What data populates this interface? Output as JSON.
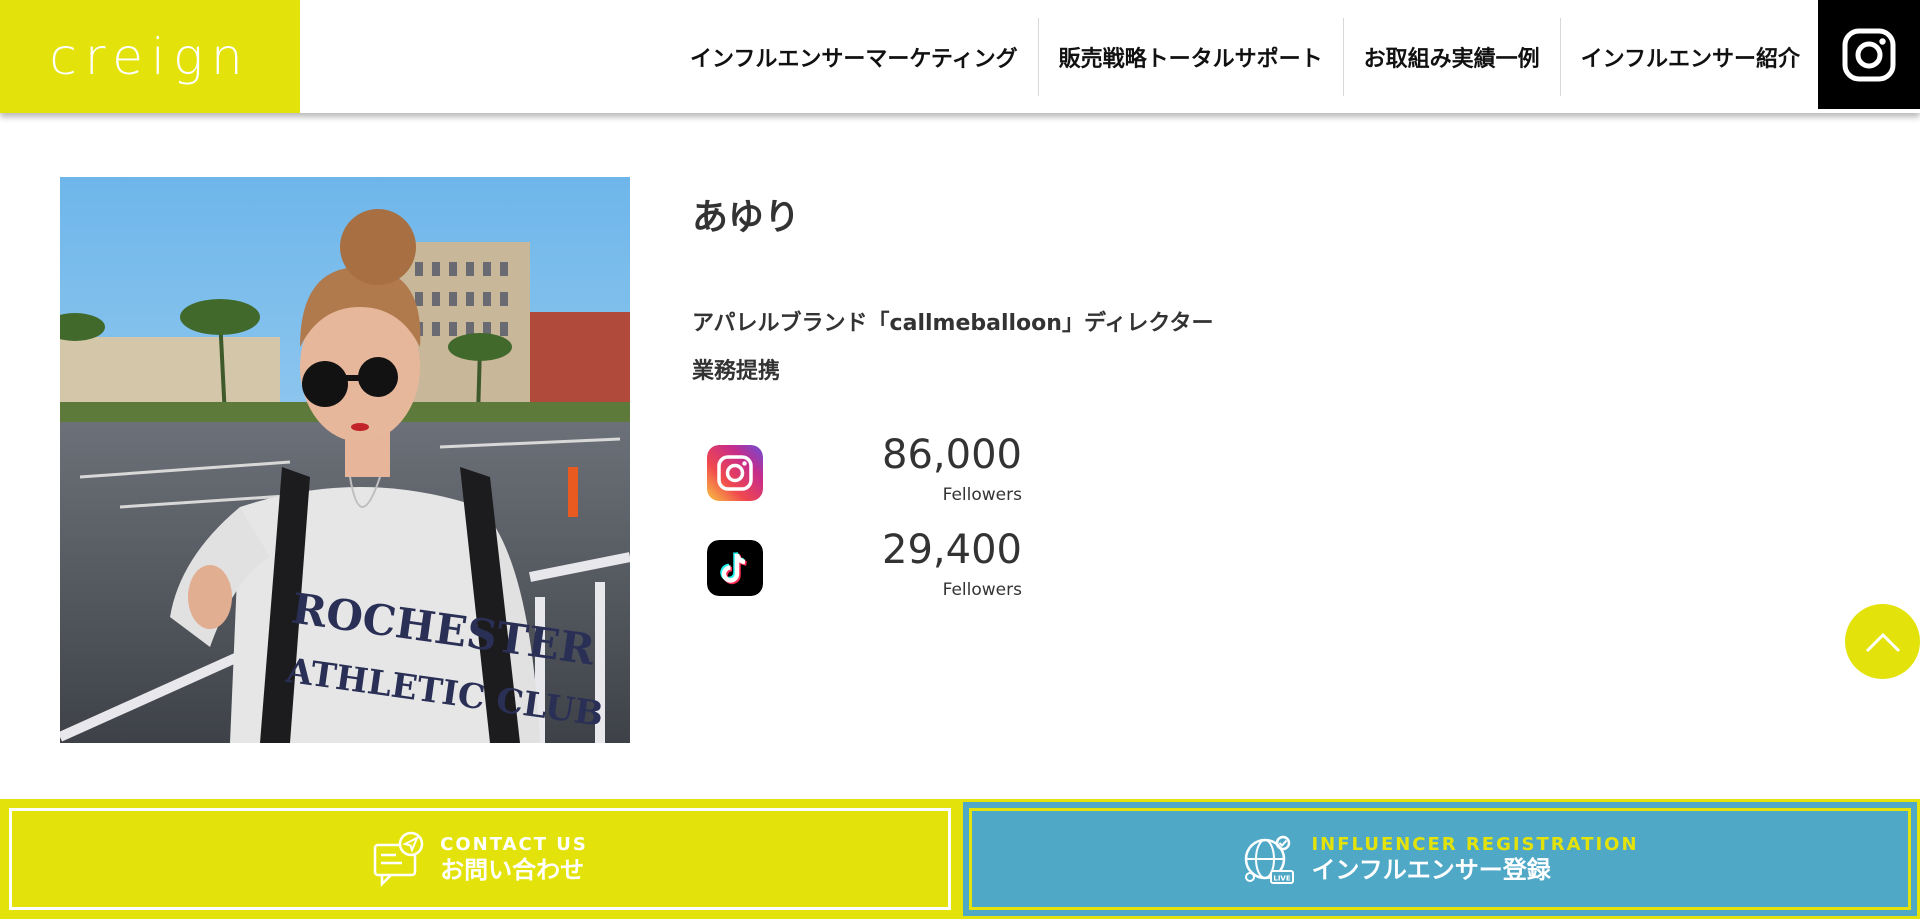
{
  "header": {
    "logo": "creign",
    "nav": [
      {
        "label": "インフルエンサーマーケティング"
      },
      {
        "label": "販売戦略トータルサポート"
      },
      {
        "label": "お取組み実績一例"
      },
      {
        "label": "インフルエンサー紹介"
      }
    ],
    "instagram_icon": "instagram-icon"
  },
  "profile": {
    "name": "あゆり",
    "description_lines": [
      "アパレルブランド「callmeballoon」ディレクター",
      "業務提携"
    ],
    "photo_text": [
      "ROCHESTER",
      "ATHLETIC CLUB"
    ],
    "stats": [
      {
        "platform_icon": "instagram-icon",
        "count": "86,000",
        "label": "Fellowers"
      },
      {
        "platform_icon": "tiktok-icon",
        "count": "29,400",
        "label": "Fellowers"
      }
    ]
  },
  "cta": {
    "contact": {
      "en": "CONTACT US",
      "jp": "お問い合わせ",
      "icon": "chat-send-icon"
    },
    "registration": {
      "en": "INFLUENCER REGISTRATION",
      "jp": "インフルエンサー登録",
      "icon": "globe-live-icon"
    }
  },
  "colors": {
    "brand_yellow": "#e3e30b",
    "registration_blue": "#4fa8c6"
  }
}
